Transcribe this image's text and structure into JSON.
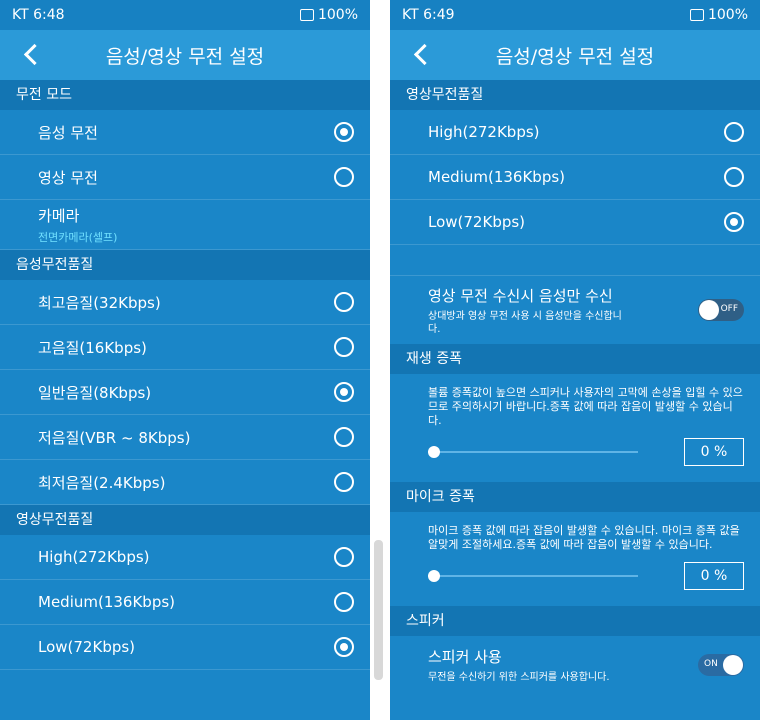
{
  "left": {
    "status": {
      "time": "KT 6:48",
      "battery": "100%"
    },
    "title": "음성/영상 무전 설정",
    "radio_mode": {
      "header": "무전 모드",
      "items": [
        {
          "label": "음성 무전",
          "checked": true
        },
        {
          "label": "영상 무전",
          "checked": false
        }
      ],
      "camera": {
        "label": "카메라",
        "value": "전면카메라(셀프)"
      }
    },
    "voice_quality": {
      "header": "음성무전품질",
      "items": [
        {
          "label": "최고음질(32Kbps)",
          "checked": false
        },
        {
          "label": "고음질(16Kbps)",
          "checked": false
        },
        {
          "label": "일반음질(8Kbps)",
          "checked": true
        },
        {
          "label": "저음질(VBR ~ 8Kbps)",
          "checked": false
        },
        {
          "label": "최저음질(2.4Kbps)",
          "checked": false
        }
      ]
    },
    "video_quality": {
      "header": "영상무전품질",
      "items": [
        {
          "label": "High(272Kbps)",
          "checked": false
        },
        {
          "label": "Medium(136Kbps)",
          "checked": false
        },
        {
          "label": "Low(72Kbps)",
          "checked": true
        }
      ]
    }
  },
  "right": {
    "status": {
      "time": "KT 6:49",
      "battery": "100%"
    },
    "title": "음성/영상 무전 설정",
    "video_quality": {
      "header": "영상무전품질",
      "items": [
        {
          "label": "High(272Kbps)",
          "checked": false
        },
        {
          "label": "Medium(136Kbps)",
          "checked": false
        },
        {
          "label": "Low(72Kbps)",
          "checked": true
        }
      ]
    },
    "voice_only": {
      "title": "영상 무전 수신시 음성만 수신",
      "desc": "상대방과 영상 무전 사용 시 음성만을 수신합니다.",
      "state": "OFF"
    },
    "playback_gain": {
      "header": "재생 증폭",
      "desc": "볼륨 증폭값이 높으면 스피커나 사용자의 고막에 손상을 입힐 수 있으므로 주의하시기 바랍니다.증폭 값에 따라 잡음이 발생할 수 있습니다.",
      "value": "0 %",
      "level": 0
    },
    "mic_gain": {
      "header": "마이크 증폭",
      "desc": "마이크 증폭 값에 따라 잡음이 발생할 수 있습니다. 마이크 증폭 값을 알맞게 조절하세요.증폭 값에 따라 잡음이 발생할 수 있습니다.",
      "value": "0 %",
      "level": 0
    },
    "speaker": {
      "header": "스피커",
      "title": "스피커 사용",
      "desc": "무전을 수신하기 위한 스피커를 사용합니다.",
      "state": "ON"
    }
  }
}
